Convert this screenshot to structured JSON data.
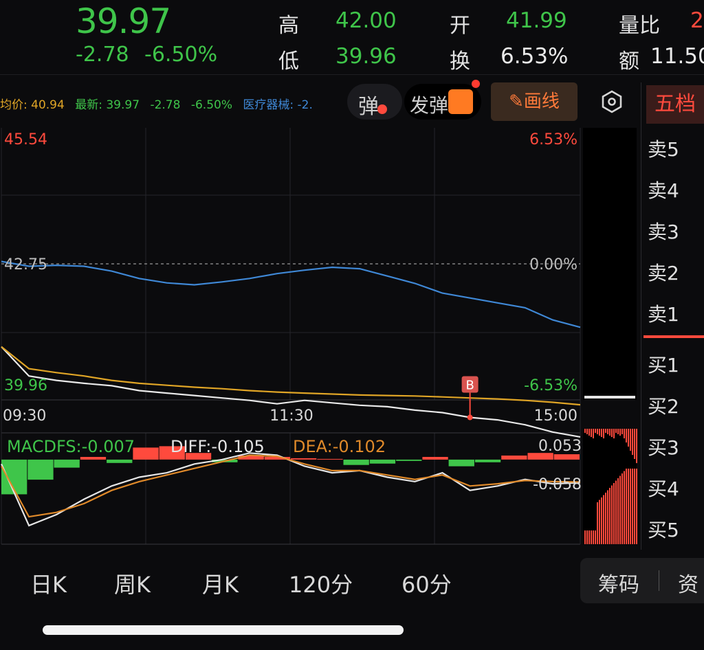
{
  "header": {
    "price": "39.97",
    "change": "-2.78",
    "change_pct": "-6.50%",
    "high_label": "高",
    "high_value": "42.00",
    "low_label": "低",
    "low_value": "39.96",
    "open_label": "开",
    "open_value": "41.99",
    "turnover_label": "换",
    "turnover_value": "6.53%",
    "volume_ratio_label": "量比",
    "volume_ratio_value": "2",
    "amount_label": "额",
    "amount_value": "11.50"
  },
  "legend": {
    "avg": "均价: 40.94",
    "latest": "最新: 39.97",
    "change": "-2.78",
    "pct": "-6.50%",
    "sector": "医疗器械: -2."
  },
  "toolbar": {
    "danmu_label": "弹",
    "send_danmu_label": "发弹",
    "draw_line_label": "画线",
    "five_level_tab": "五档"
  },
  "order_book": {
    "sell": [
      "卖5",
      "卖4",
      "卖3",
      "卖2",
      "卖1"
    ],
    "buy": [
      "买1",
      "买2",
      "买3",
      "买4",
      "买5"
    ]
  },
  "bottom_tabs": [
    "日K",
    "周K",
    "月K",
    "120分",
    "60分"
  ],
  "right_tabs": [
    "筹码",
    "资"
  ],
  "colors": {
    "up": "#ff4a3d",
    "down": "#3fc54a",
    "avg": "#e0a526",
    "sector": "#3f88d6",
    "price": "#e9e9e9"
  },
  "chart_data": [
    {
      "type": "line",
      "title": "",
      "x_ticks": [
        "09:30",
        "11:30",
        "15:00"
      ],
      "y_ticks_left": [
        "45.54",
        "42.75",
        "39.96"
      ],
      "y_ticks_right": [
        "6.53%",
        "0.00%",
        "-6.53%"
      ],
      "ylim": [
        39.96,
        45.54
      ],
      "prev_close": 42.75,
      "series": [
        {
          "name": "最新",
          "values": [
            41.05,
            40.45,
            40.36,
            40.3,
            40.25,
            40.15,
            40.1,
            40.05,
            40.0,
            39.95,
            39.88,
            39.95,
            39.9,
            39.85,
            39.82,
            39.75,
            39.7,
            39.6,
            39.55,
            39.45,
            39.3,
            39.2
          ]
        },
        {
          "name": "均价",
          "values": [
            41.05,
            40.6,
            40.52,
            40.45,
            40.36,
            40.3,
            40.26,
            40.22,
            40.19,
            40.15,
            40.12,
            40.1,
            40.08,
            40.06,
            40.05,
            40.04,
            40.02,
            40.0,
            39.98,
            39.95,
            39.91,
            39.86
          ]
        },
        {
          "name": "医疗器械",
          "values": [
            42.8,
            42.7,
            42.72,
            42.7,
            42.6,
            42.45,
            42.36,
            42.32,
            42.38,
            42.45,
            42.55,
            42.62,
            42.68,
            42.65,
            42.5,
            42.35,
            42.15,
            42.05,
            41.95,
            41.85,
            41.6,
            41.45
          ]
        }
      ],
      "annotations": [
        {
          "label": "B",
          "x_index": 17
        }
      ]
    },
    {
      "type": "bar",
      "title": "",
      "labels": {
        "macd": "MACDFS:-0.007",
        "diff": "DIFF:-0.105",
        "dea": "DEA:-0.102"
      },
      "y_ticks_right": [
        "0.053",
        "-0.058"
      ],
      "ylim": [
        -0.058,
        0.053
      ],
      "macd": [
        -0.052,
        -0.03,
        -0.012,
        0.004,
        -0.005,
        0.018,
        0.02,
        0.01,
        -0.004,
        0.006,
        0.004,
        0.002,
        0.001,
        -0.008,
        -0.006,
        -0.002,
        0.004,
        -0.01,
        -0.004,
        0.006,
        0.01,
        0.008
      ],
      "series": [
        {
          "name": "DIFF",
          "values": [
            -0.02,
            -0.3,
            -0.25,
            -0.18,
            -0.12,
            -0.08,
            -0.06,
            -0.02,
            0.0,
            0.03,
            0.02,
            -0.03,
            -0.06,
            -0.05,
            -0.08,
            -0.1,
            -0.06,
            -0.14,
            -0.12,
            -0.09,
            -0.11,
            -0.105
          ]
        },
        {
          "name": "DEA",
          "values": [
            -0.03,
            -0.26,
            -0.24,
            -0.2,
            -0.14,
            -0.1,
            -0.07,
            -0.04,
            -0.01,
            0.02,
            0.015,
            -0.02,
            -0.05,
            -0.05,
            -0.07,
            -0.09,
            -0.07,
            -0.12,
            -0.11,
            -0.095,
            -0.1,
            -0.102
          ]
        }
      ]
    }
  ]
}
